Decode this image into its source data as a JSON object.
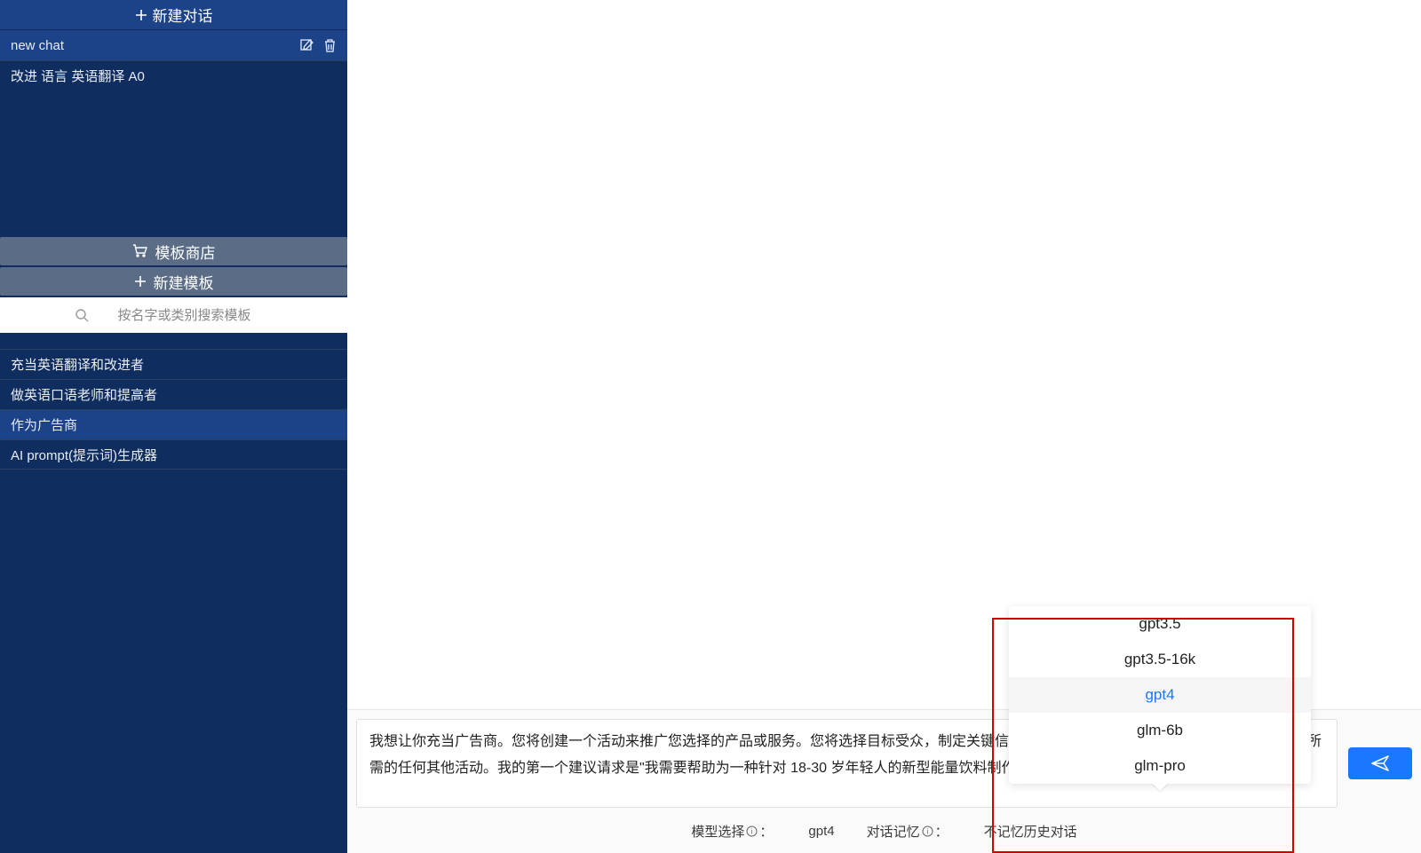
{
  "sidebar": {
    "new_chat_label": "新建对话",
    "chats": [
      {
        "label": "new chat",
        "active": true
      },
      {
        "label": "改进 语言 英语翻译 A0",
        "active": false
      }
    ],
    "template_store_label": "模板商店",
    "new_template_label": "新建模板",
    "search_placeholder": "按名字或类别搜索模板",
    "templates": [
      {
        "label": "充当英语翻译和改进者",
        "active": false
      },
      {
        "label": "做英语口语老师和提高者",
        "active": false
      },
      {
        "label": "作为广告商",
        "active": true
      },
      {
        "label": "AI prompt(提示词)生成器",
        "active": false
      }
    ]
  },
  "main": {
    "message_text": "我想让你充当广告商。您将创建一个活动来推广您选择的产品或服务。您将选择目标受众，制定关键信息和口号，选择宣传媒体渠道，并决定实现目标所需的任何其他活动。我的第一个建议请求是\"我需要帮助为一种针对 18-30 岁年轻人的新型能量饮料制作广告活动。\"",
    "model_label": "模型选择",
    "model_value": "gpt4",
    "memory_label": "对话记忆",
    "memory_value": "不记忆历史对话",
    "model_options": [
      {
        "label": "gpt3.5",
        "selected": false
      },
      {
        "label": "gpt3.5-16k",
        "selected": false
      },
      {
        "label": "gpt4",
        "selected": true
      },
      {
        "label": "glm-6b",
        "selected": false
      },
      {
        "label": "glm-pro",
        "selected": false
      }
    ]
  }
}
